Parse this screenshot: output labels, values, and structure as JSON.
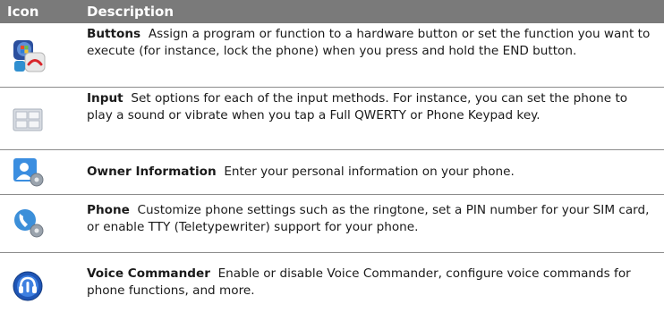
{
  "table": {
    "header": {
      "icon": "Icon",
      "description": "Description"
    },
    "rows": [
      {
        "icon": "buttons-icon",
        "title": "Buttons",
        "text": "Assign a program or function to a hardware button or set the function you want to execute (for instance, lock the phone) when you press and hold the END button."
      },
      {
        "icon": "input-icon",
        "title": "Input",
        "text": "Set options for each of the input methods. For instance, you can set the phone to play a sound or vibrate when you tap a Full QWERTY or Phone Keypad key."
      },
      {
        "icon": "owner-information-icon",
        "title": "Owner Information",
        "text": "Enter your personal information on your phone."
      },
      {
        "icon": "phone-icon",
        "title": "Phone",
        "text": "Customize phone settings such as the ringtone, set a PIN number for your SIM card, or enable TTY (Teletypewriter) support for your phone."
      },
      {
        "icon": "voice-commander-icon",
        "title": "Voice Commander",
        "text": "Enable or disable Voice Commander, configure voice commands for phone functions, and more."
      }
    ]
  },
  "colors": {
    "header_bg": "#7a7a7a",
    "header_text": "#ffffff",
    "row_border": "#8c8c8c"
  }
}
